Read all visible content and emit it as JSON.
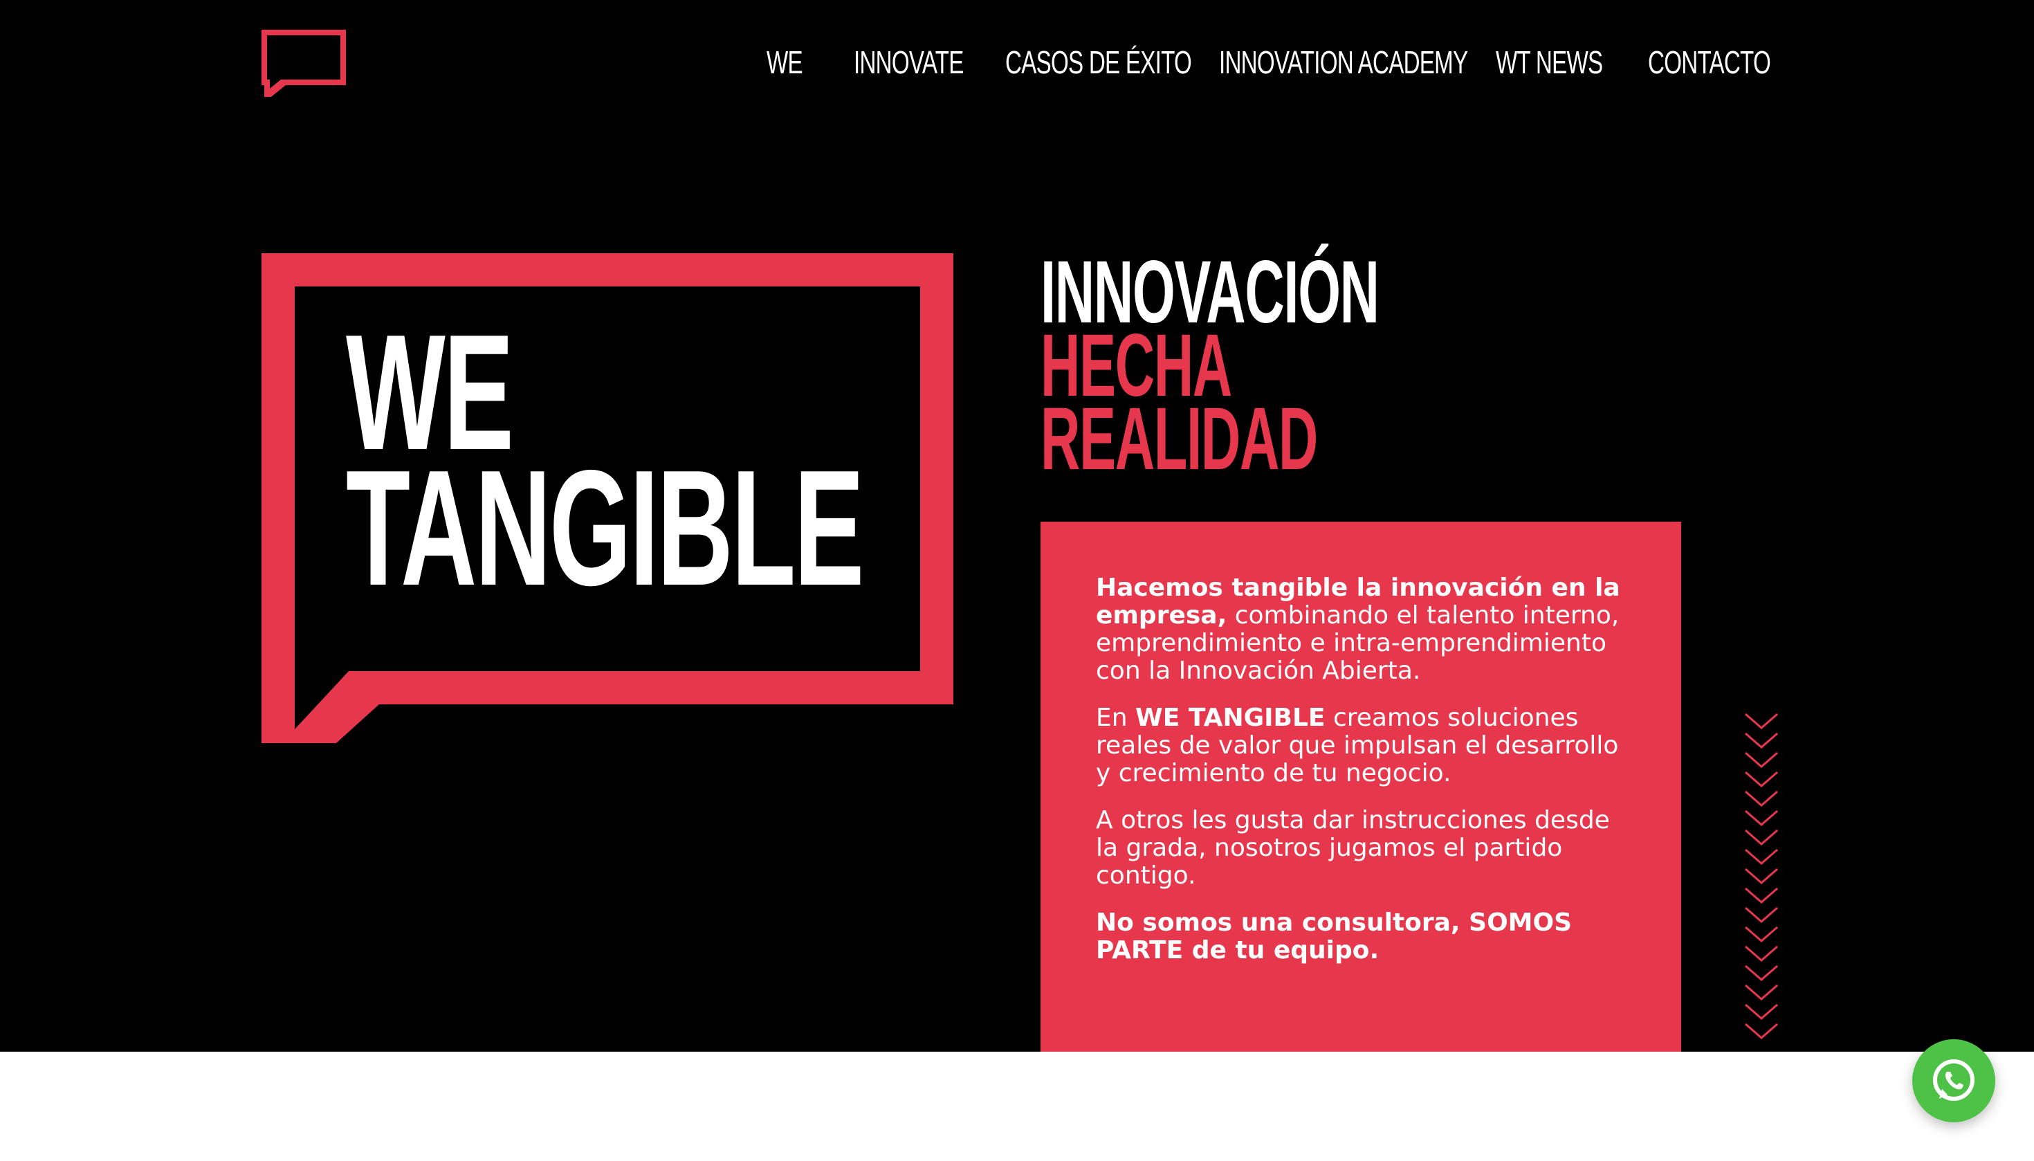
{
  "nav": {
    "items": [
      {
        "label": "WE"
      },
      {
        "label": "INNOVATE"
      },
      {
        "label": "CASOS DE ÉXITO"
      },
      {
        "label": "INNOVATION ACADEMY"
      },
      {
        "label": "WT NEWS"
      },
      {
        "label": "CONTACTO"
      }
    ]
  },
  "brand": {
    "line1": "WE",
    "line2": "TANGIBLE"
  },
  "headline": {
    "line1": "INNOVACIÓN",
    "line2": "HECHA",
    "line3": "REALIDAD"
  },
  "card": {
    "p1_bold": "Hacemos tangible la innovación en la empresa,",
    "p1_rest": " combinando el talento interno, emprendimiento e intra-emprendimiento con la Innovación Abierta.",
    "p2_pre": "En ",
    "p2_bold": "WE TANGIBLE",
    "p2_rest": " creamos soluciones reales de valor que impulsan el desarrollo y crecimiento de tu negocio.",
    "p3": "A otros les gusta dar instrucciones desde la grada, nosotros jugamos el partido contigo.",
    "p4_bold": "No somos una consultora, SOMOS PARTE de tu equipo."
  },
  "icons": {
    "logo": "speech-bubble-logo-icon",
    "whatsapp": "whatsapp-icon",
    "decoration": "chevron-down-stack-icon"
  },
  "colors": {
    "accent": "#e7374d",
    "background": "#000000",
    "text": "#ffffff",
    "whatsapp": "#4dc247"
  }
}
